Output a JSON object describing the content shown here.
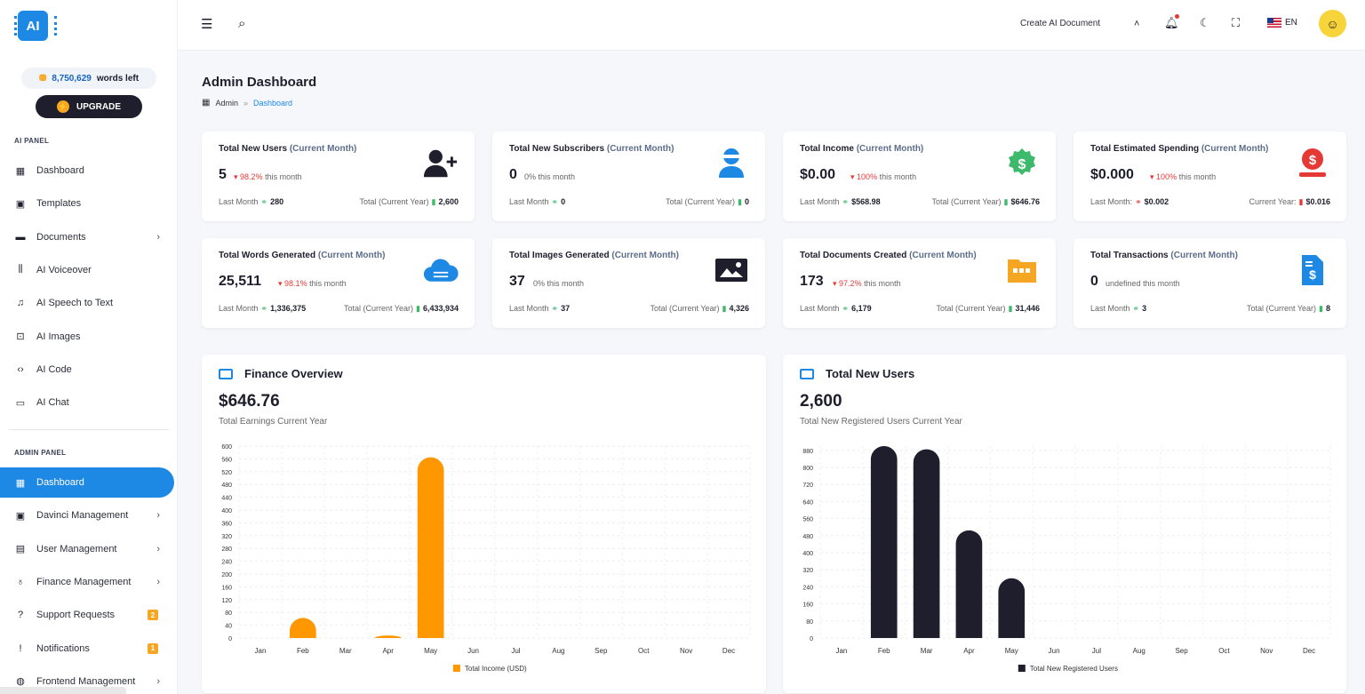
{
  "sidebar": {
    "logo_text": "AI",
    "words_left": "8,750,629",
    "words_left_suffix": "words left",
    "upgrade_label": "UPGRADE",
    "ai_panel_title": "AI PANEL",
    "ai_items": [
      {
        "label": "Dashboard",
        "icon": "dashboard-icon"
      },
      {
        "label": "Templates",
        "icon": "ai-chip-icon"
      },
      {
        "label": "Documents",
        "icon": "folder-icon"
      },
      {
        "label": "AI Voiceover",
        "icon": "waveform-icon"
      },
      {
        "label": "AI Speech to Text",
        "icon": "music-note-icon"
      },
      {
        "label": "AI Images",
        "icon": "image-scan-icon"
      },
      {
        "label": "AI Code",
        "icon": "code-icon"
      },
      {
        "label": "AI Chat",
        "icon": "chat-icon"
      }
    ],
    "admin_panel_title": "ADMIN PANEL",
    "admin_items": [
      {
        "label": "Dashboard",
        "icon": "dashboard-icon"
      },
      {
        "label": "Davinci Management",
        "icon": "ai-chip-icon"
      },
      {
        "label": "User Management",
        "icon": "user-badge-icon"
      },
      {
        "label": "Finance Management",
        "icon": "money-bag-icon"
      },
      {
        "label": "Support Requests",
        "icon": "help-icon",
        "badge": "2"
      },
      {
        "label": "Notifications",
        "icon": "alert-icon",
        "badge": "1"
      },
      {
        "label": "Frontend Management",
        "icon": "globe-icon"
      }
    ]
  },
  "header": {
    "create_doc_label": "Create AI Document",
    "lang_label": "EN"
  },
  "page": {
    "title": "Admin Dashboard",
    "breadcrumb_root": "Admin",
    "breadcrumb_sep": "»",
    "breadcrumb_current": "Dashboard"
  },
  "stats": [
    {
      "title": "Total New Users",
      "sub": "(Current Month)",
      "value": "5",
      "pct": "98.2%",
      "pct_suffix": "this month",
      "left_label": "Last Month",
      "left_value": "280",
      "right_label": "Total (Current Year)",
      "right_value": "2,600",
      "icon": "add-user-icon"
    },
    {
      "title": "Total New Subscribers",
      "sub": "(Current Month)",
      "value": "0",
      "pct": "0%",
      "pct_suffix": "this month",
      "left_label": "Last Month",
      "left_value": "0",
      "right_label": "Total (Current Year)",
      "right_value": "0",
      "icon": "agent-icon"
    },
    {
      "title": "Total Income",
      "sub": "(Current Month)",
      "value": "$0.00",
      "pct": "100%",
      "pct_suffix": "this month",
      "left_label": "Last Month",
      "left_value": "$568.98",
      "right_label": "Total (Current Year)",
      "right_value": "$646.76",
      "icon": "dollar-badge-icon"
    },
    {
      "title": "Total Estimated Spending",
      "sub": "(Current Month)",
      "value": "$0.000",
      "pct": "100%",
      "pct_suffix": "this month",
      "left_label": "Last Month:",
      "left_value": "$0.002",
      "right_label": "Current Year:",
      "right_value": "$0.016",
      "icon": "dollar-hand-icon"
    },
    {
      "title": "Total Words Generated",
      "sub": "(Current Month)",
      "value": "25,511",
      "pct": "98.1%",
      "pct_suffix": "this month",
      "left_label": "Last Month",
      "left_value": "1,336,375",
      "right_label": "Total (Current Year)",
      "right_value": "6,433,934",
      "icon": "cloud-icon"
    },
    {
      "title": "Total Images Generated",
      "sub": "(Current Month)",
      "value": "37",
      "pct": "0%",
      "pct_suffix": "this month",
      "left_label": "Last Month",
      "left_value": "37",
      "right_label": "Total (Current Year)",
      "right_value": "4,326",
      "icon": "picture-icon"
    },
    {
      "title": "Total Documents Created",
      "sub": "(Current Month)",
      "value": "173",
      "pct": "97.2%",
      "pct_suffix": "this month",
      "left_label": "Last Month",
      "left_value": "6,179",
      "right_label": "Total (Current Year)",
      "right_value": "31,446",
      "icon": "folder-docs-icon"
    },
    {
      "title": "Total Transactions",
      "sub": "(Current Month)",
      "value": "0",
      "pct": "undefined",
      "pct_suffix": "this month",
      "left_label": "Last Month",
      "left_value": "3",
      "right_label": "Total (Current Year)",
      "right_value": "8",
      "icon": "invoice-icon"
    }
  ],
  "finance": {
    "title": "Finance Overview",
    "value": "$646.76",
    "subtitle": "Total Earnings Current Year"
  },
  "users": {
    "title": "Total New Users",
    "value": "2,600",
    "subtitle": "Total New Registered Users Current Year"
  },
  "chart_data": [
    {
      "type": "bar",
      "categories": [
        "Jan",
        "Feb",
        "Mar",
        "Apr",
        "May",
        "Jun",
        "Jul",
        "Aug",
        "Sep",
        "Oct",
        "Nov",
        "Dec"
      ],
      "series": [
        {
          "name": "Total Income (USD)",
          "values": [
            0,
            63,
            0,
            8,
            565,
            0,
            0,
            0,
            0,
            0,
            0,
            0
          ]
        }
      ],
      "ylim": [
        0,
        600
      ],
      "yticks": [
        0,
        40,
        80,
        120,
        160,
        200,
        240,
        280,
        320,
        360,
        400,
        440,
        480,
        520,
        560,
        600
      ],
      "color": "#ff9800",
      "legend": "bottom"
    },
    {
      "type": "bar",
      "categories": [
        "Jan",
        "Feb",
        "Mar",
        "Apr",
        "May",
        "Jun",
        "Jul",
        "Aug",
        "Sep",
        "Oct",
        "Nov",
        "Dec"
      ],
      "series": [
        {
          "name": "Total New Registered Users",
          "values": [
            0,
            900,
            885,
            505,
            280,
            0,
            0,
            0,
            0,
            0,
            0,
            0
          ]
        }
      ],
      "ylim": [
        0,
        900
      ],
      "yticks": [
        0,
        80,
        160,
        240,
        320,
        400,
        480,
        560,
        640,
        720,
        800,
        880
      ],
      "color": "#1e1e2d",
      "legend": "bottom"
    }
  ]
}
